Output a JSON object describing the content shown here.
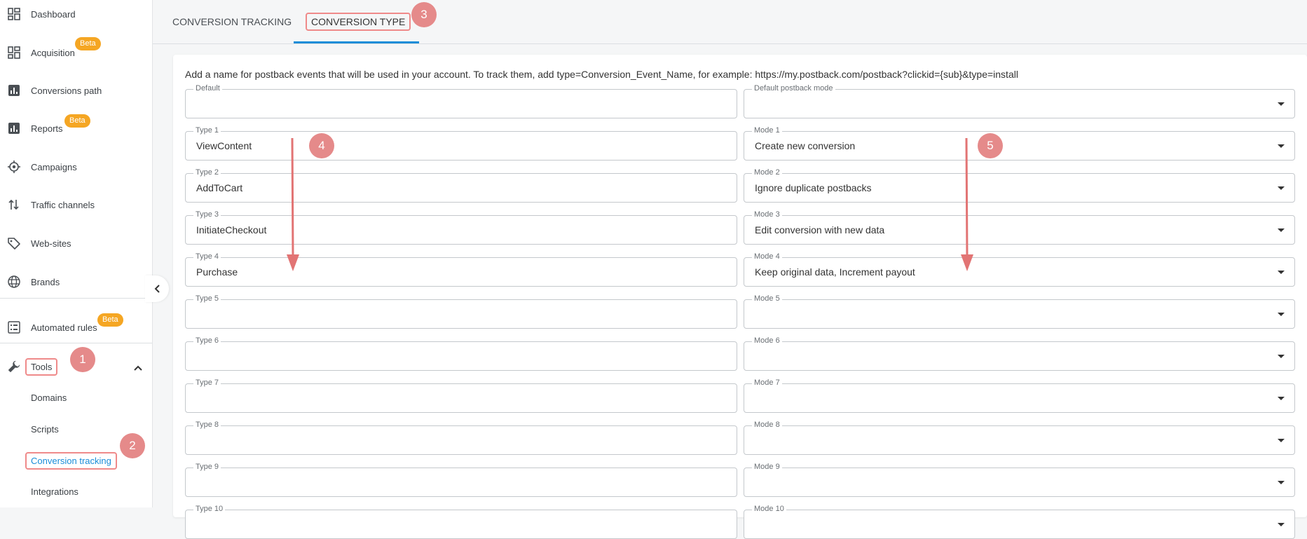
{
  "sidebar": {
    "items": [
      {
        "label": "Dashboard",
        "icon": "dashboard-icon"
      },
      {
        "label": "Acquisition",
        "icon": "acquisition-icon",
        "badge": "Beta"
      },
      {
        "label": "Conversions path",
        "icon": "bar-chart-icon"
      },
      {
        "label": "Reports",
        "icon": "reports-icon",
        "badge": "Beta"
      },
      {
        "label": "Campaigns",
        "icon": "target-icon"
      },
      {
        "label": "Traffic channels",
        "icon": "traffic-arrows-icon"
      },
      {
        "label": "Web-sites",
        "icon": "tag-icon"
      },
      {
        "label": "Brands",
        "icon": "globe-icon"
      },
      {
        "label": "Automated rules",
        "icon": "list-icon",
        "badge": "Beta"
      },
      {
        "label": "Tools",
        "icon": "wrench-icon"
      }
    ],
    "tools_sub": [
      "Domains",
      "Scripts",
      "Conversion tracking",
      "Integrations"
    ]
  },
  "steps": [
    "1",
    "2",
    "3",
    "4",
    "5"
  ],
  "tabs": [
    {
      "label": "CONVERSION TRACKING"
    },
    {
      "label": "CONVERSION TYPE"
    }
  ],
  "description": "Add a name for postback events that will be used in your account. To track them, add type=Conversion_Event_Name, for example: https://my.postback.com/postback?clickid={sub}&type=install",
  "default_row": {
    "type_label": "Default",
    "type_value": "",
    "mode_label": "Default postback mode",
    "mode_value": ""
  },
  "rows": [
    {
      "type_label": "Type 1",
      "type_value": "ViewContent",
      "mode_label": "Mode 1",
      "mode_value": "Create new conversion"
    },
    {
      "type_label": "Type 2",
      "type_value": "AddToCart",
      "mode_label": "Mode 2",
      "mode_value": "Ignore duplicate postbacks"
    },
    {
      "type_label": "Type 3",
      "type_value": "InitiateCheckout",
      "mode_label": "Mode 3",
      "mode_value": "Edit conversion with new data"
    },
    {
      "type_label": "Type 4",
      "type_value": "Purchase",
      "mode_label": "Mode 4",
      "mode_value": "Keep original data, Increment payout"
    },
    {
      "type_label": "Type 5",
      "type_value": "",
      "mode_label": "Mode 5",
      "mode_value": ""
    },
    {
      "type_label": "Type 6",
      "type_value": "",
      "mode_label": "Mode 6",
      "mode_value": ""
    },
    {
      "type_label": "Type 7",
      "type_value": "",
      "mode_label": "Mode 7",
      "mode_value": ""
    },
    {
      "type_label": "Type 8",
      "type_value": "",
      "mode_label": "Mode 8",
      "mode_value": ""
    },
    {
      "type_label": "Type 9",
      "type_value": "",
      "mode_label": "Mode 9",
      "mode_value": ""
    },
    {
      "type_label": "Type 10",
      "type_value": "",
      "mode_label": "Mode 10",
      "mode_value": ""
    }
  ],
  "colors": {
    "accent": "#1a8dd8",
    "badge": "#f5a623",
    "annotation": "#e58a8a"
  }
}
